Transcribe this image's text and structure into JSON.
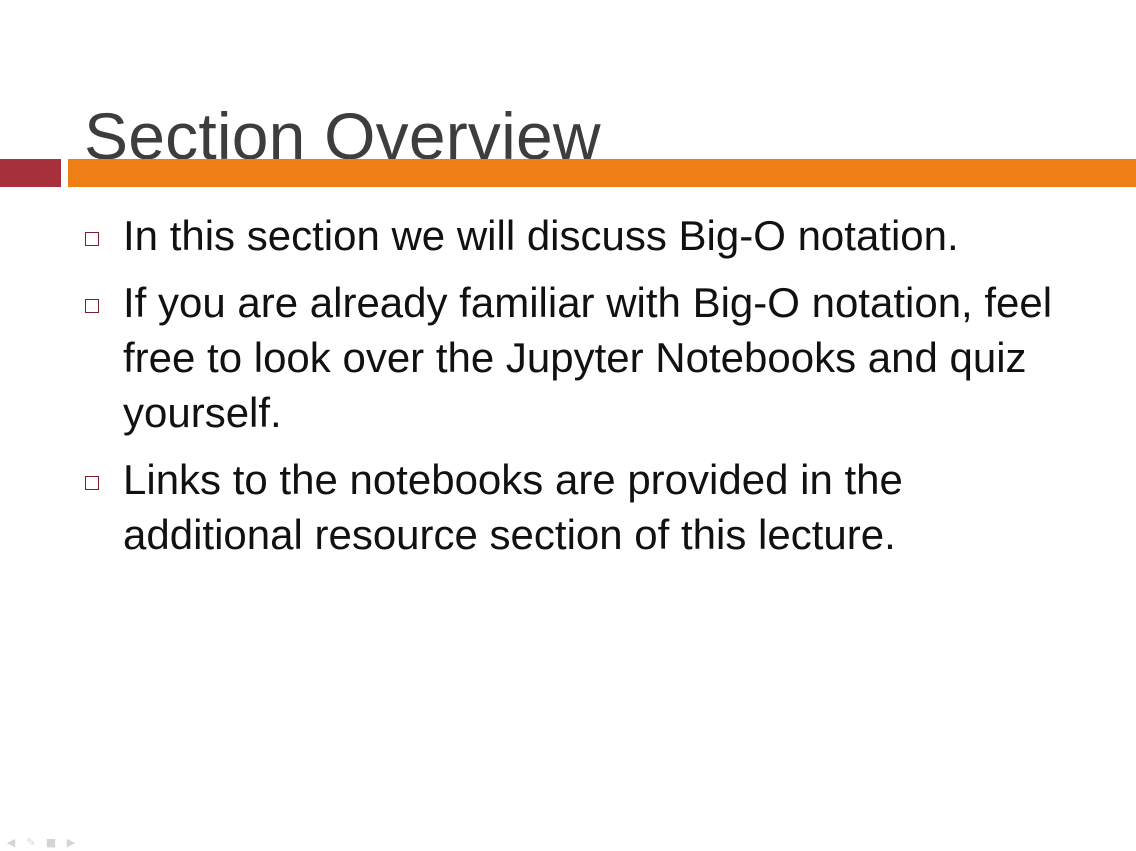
{
  "slide": {
    "title": "Section Overview",
    "bullets": [
      {
        "text": "In this section we will discuss Big-O notation."
      },
      {
        "text": "If you are already familiar with Big-O notation, feel free to look over the Jupyter Notebooks and quiz yourself."
      },
      {
        "text": "Links to the notebooks are provided in the additional resource section of this lecture."
      }
    ]
  },
  "colors": {
    "accent_dark": "#a6303b",
    "accent_orange": "#ee7f15",
    "title_text": "#3d3d3d",
    "bullet_marker": "#7a1f2b"
  },
  "player_controls": {
    "icons": [
      "prev-arrow-icon",
      "pen-icon",
      "menu-icon",
      "next-arrow-icon"
    ]
  }
}
